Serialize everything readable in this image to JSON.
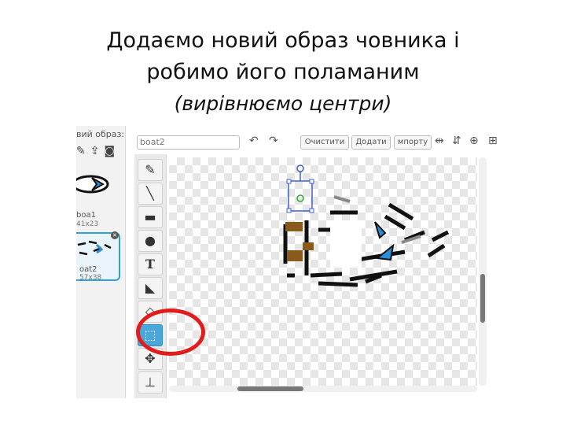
{
  "slide": {
    "title_line1": "Додаємо новий образ човника і",
    "title_line2": "робимо його поламаним",
    "title_line3": "(вирівнюємо центри)"
  },
  "editor": {
    "new_costume_label": "вий образ:",
    "costume_name_value": "boat2",
    "buttons": {
      "clear": "Очистити",
      "add": "Додати",
      "import": "мпорту"
    },
    "costumes": [
      {
        "name": "boa1",
        "size": "41x23"
      },
      {
        "name": "oat2",
        "size": "57x38"
      }
    ],
    "tools": [
      "brush-icon",
      "line-icon",
      "rectangle-icon",
      "ellipse-icon",
      "text-icon",
      "fill-icon",
      "eraser-icon",
      "select-icon",
      "stamp-select-icon",
      "stamp-icon"
    ],
    "active_tool": "select-icon",
    "accent_color": "#4aa7da",
    "highlight_color": "#e21b1b"
  }
}
